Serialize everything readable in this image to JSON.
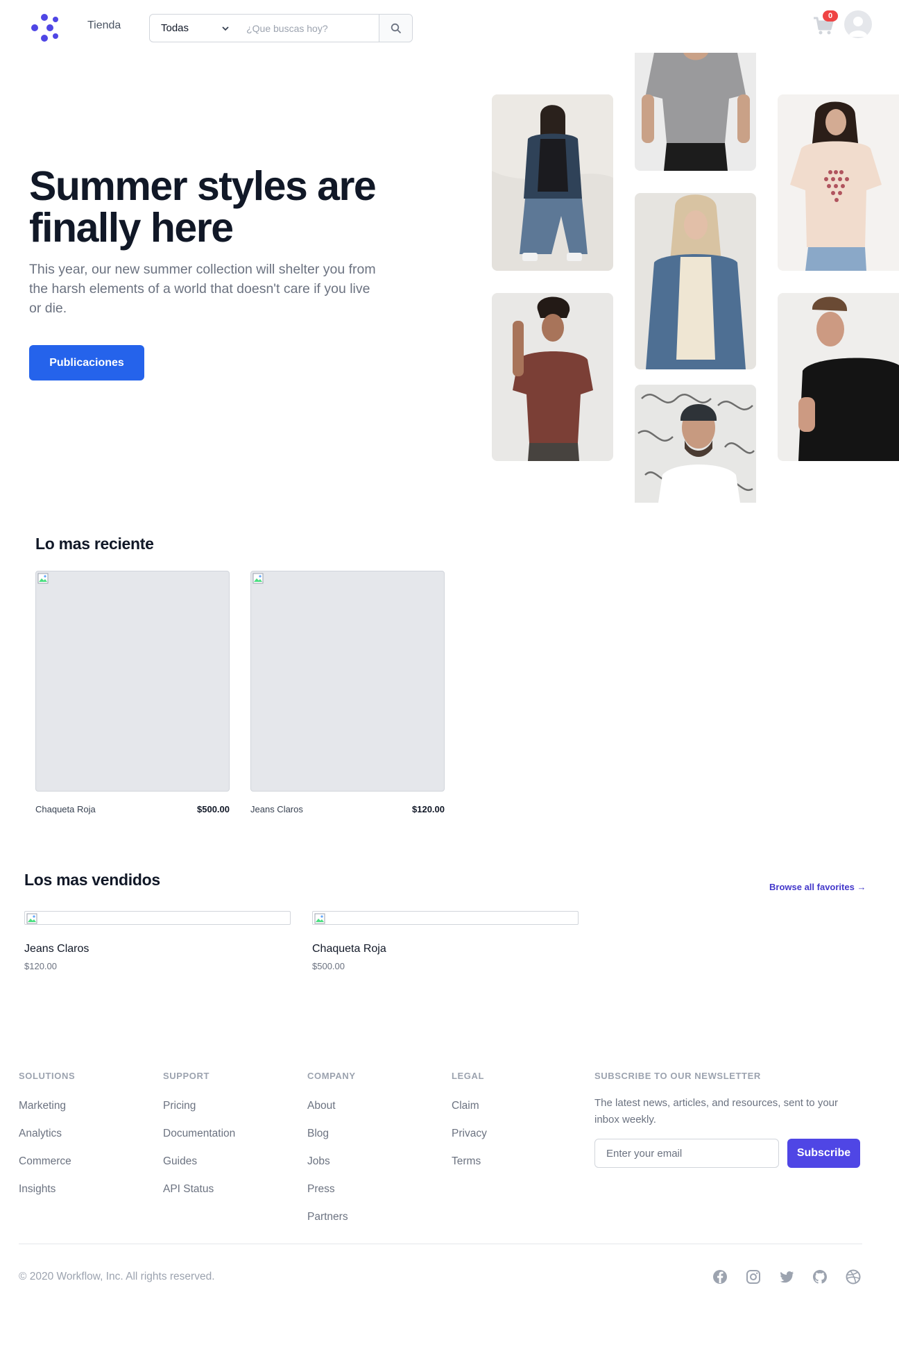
{
  "header": {
    "nav_label": "Tienda",
    "category_selected": "Todas",
    "search_placeholder": "¿Que buscas hoy?",
    "cart_count": "0",
    "brand_color": "#4f46e5"
  },
  "hero": {
    "title": "Summer styles are finally here",
    "description": "This year, our new summer collection will shelter you from the harsh elements of a world that doesn't care if you live or die.",
    "button_label": "Publicaciones",
    "button_color": "#2563eb"
  },
  "recent": {
    "title": "Lo mas reciente",
    "products": [
      {
        "name": "Chaqueta Roja",
        "price": "$500.00"
      },
      {
        "name": "Jeans Claros",
        "price": "$120.00"
      }
    ]
  },
  "bestsellers": {
    "title": "Los mas vendidos",
    "browse_label": "Browse all favorites →",
    "products": [
      {
        "name": "Jeans Claros",
        "price": "$120.00"
      },
      {
        "name": "Chaqueta Roja",
        "price": "$500.00"
      }
    ]
  },
  "footer": {
    "columns": [
      {
        "heading": "SOLUTIONS",
        "links": [
          "Marketing",
          "Analytics",
          "Commerce",
          "Insights"
        ]
      },
      {
        "heading": "SUPPORT",
        "links": [
          "Pricing",
          "Documentation",
          "Guides",
          "API Status"
        ]
      },
      {
        "heading": "COMPANY",
        "links": [
          "About",
          "Blog",
          "Jobs",
          "Press",
          "Partners"
        ]
      },
      {
        "heading": "LEGAL",
        "links": [
          "Claim",
          "Privacy",
          "Terms"
        ]
      }
    ],
    "newsletter": {
      "heading": "SUBSCRIBE TO OUR NEWSLETTER",
      "text": "The latest news, articles, and resources, sent to your inbox weekly.",
      "email_placeholder": "Enter your email",
      "button_label": "Subscribe"
    },
    "copyright": "© 2020 Workflow, Inc. All rights reserved.",
    "social_icons": [
      "facebook-icon",
      "instagram-icon",
      "twitter-icon",
      "github-icon",
      "dribbble-icon"
    ]
  }
}
